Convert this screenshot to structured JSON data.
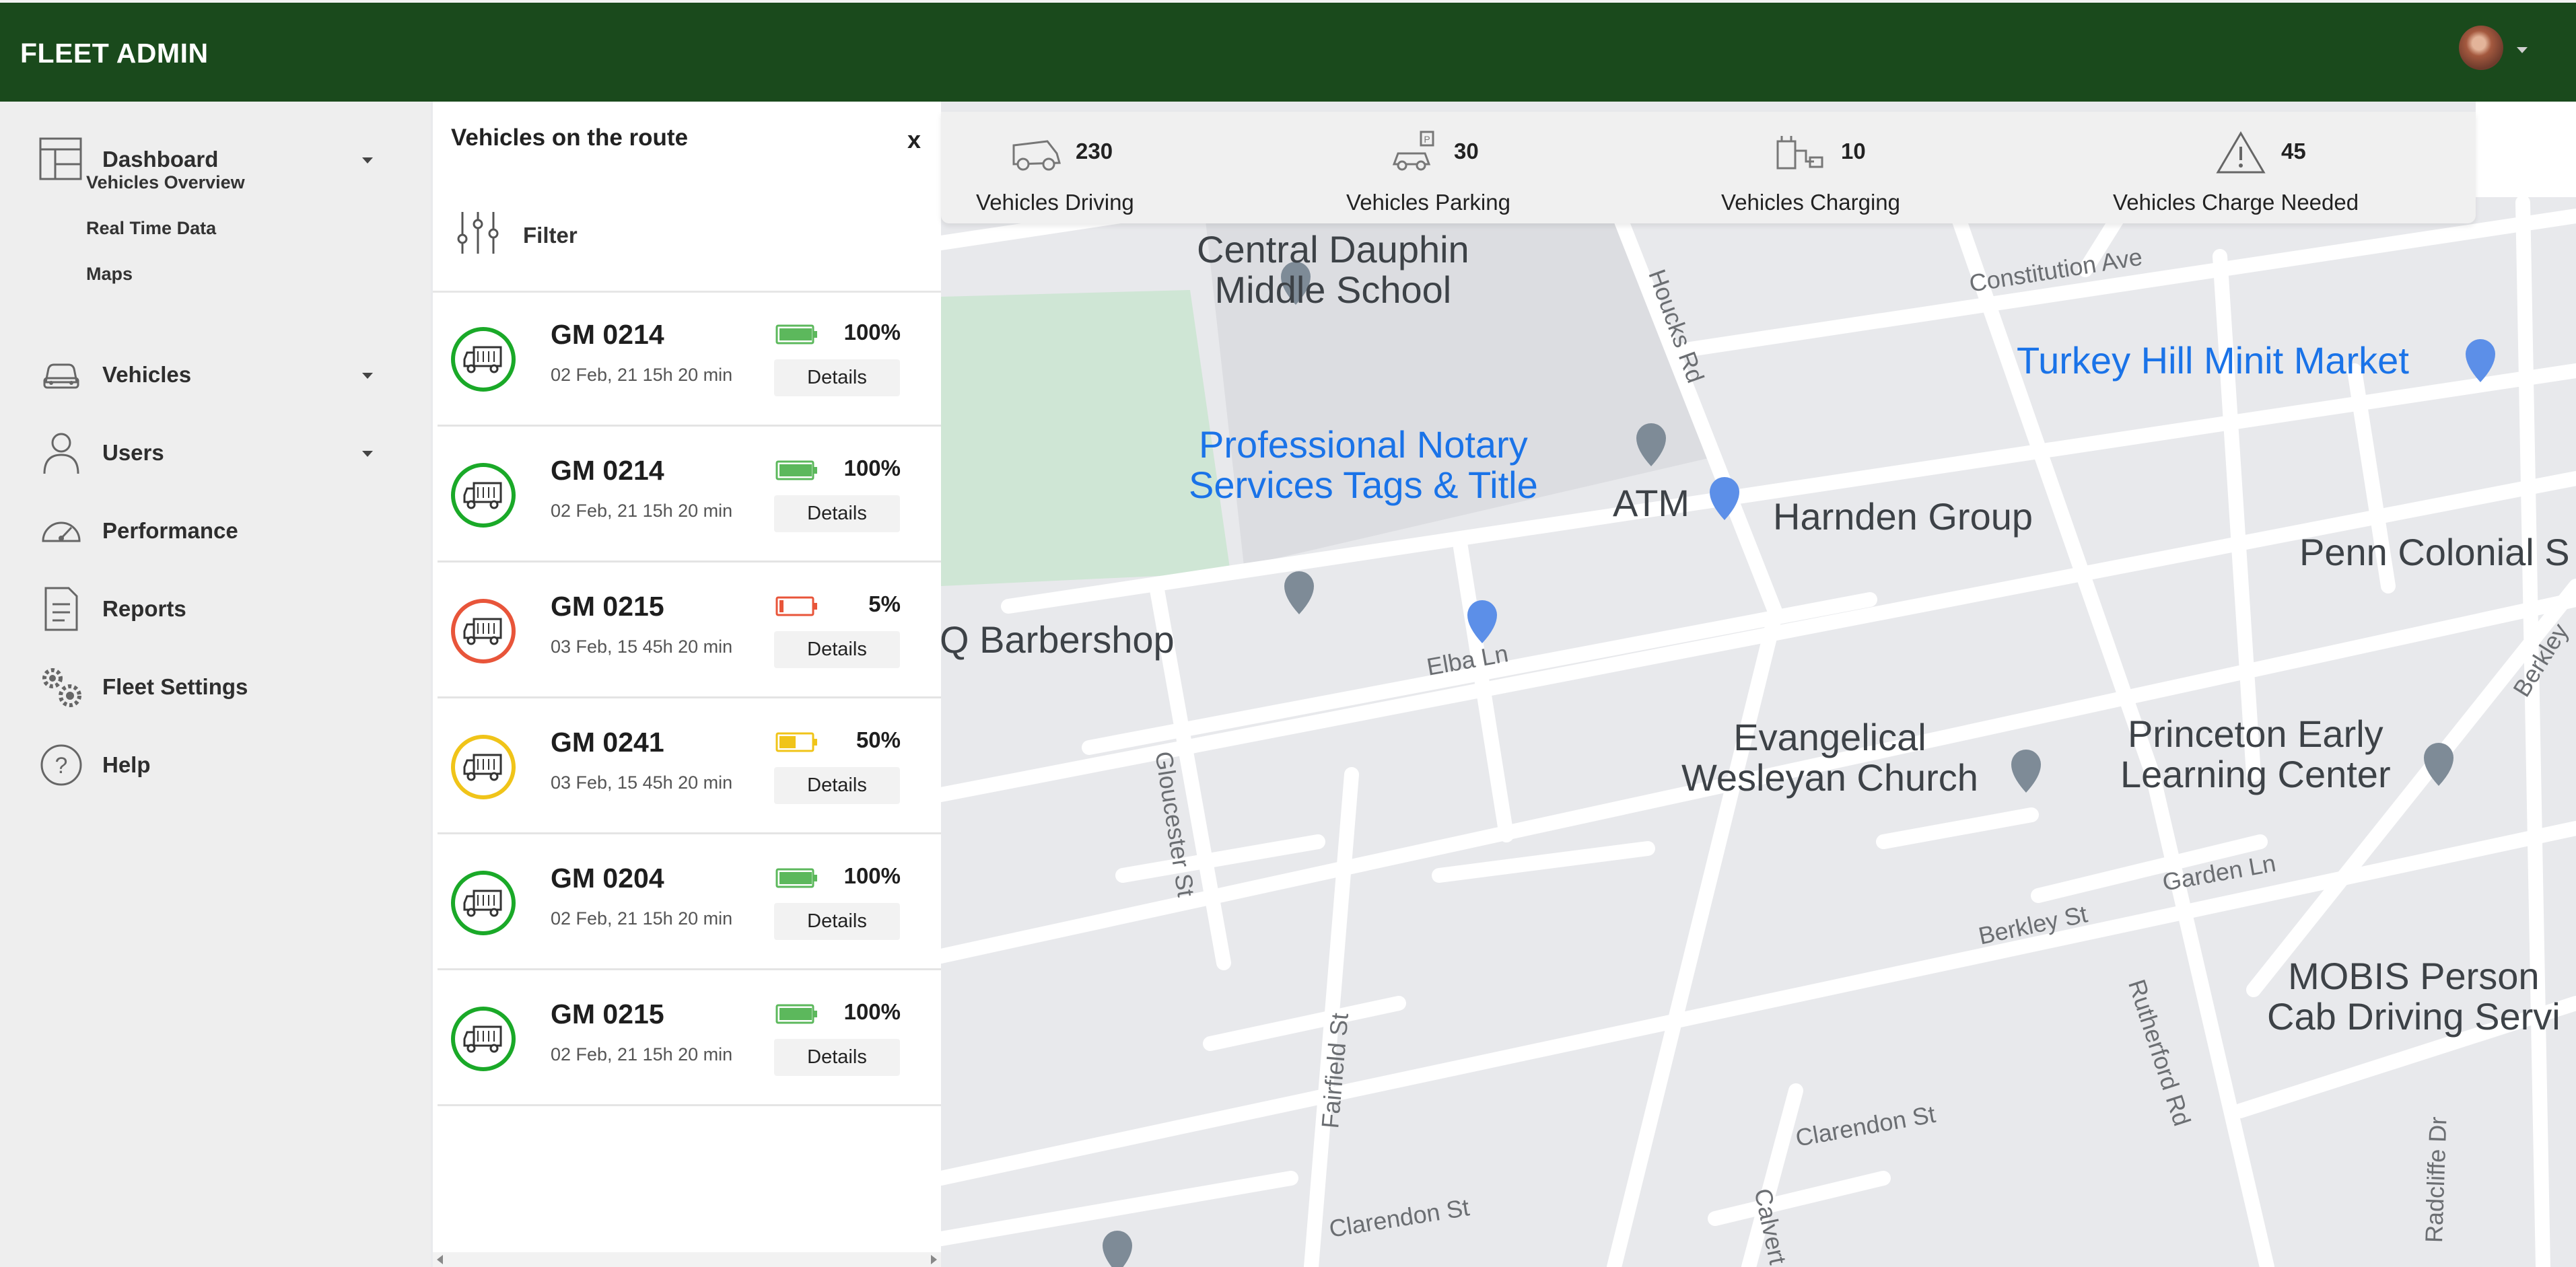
{
  "app": {
    "title": "FLEET ADMIN"
  },
  "sidebar": {
    "dashboard": {
      "label": "Dashboard",
      "subitems": [
        "Vehicles Overview",
        "Real Time Data",
        "Maps"
      ]
    },
    "items": [
      {
        "label": "Vehicles",
        "icon": "car-icon"
      },
      {
        "label": "Users",
        "icon": "user-icon"
      },
      {
        "label": "Performance",
        "icon": "gauge-icon"
      },
      {
        "label": "Reports",
        "icon": "report-icon"
      },
      {
        "label": "Fleet Settings",
        "icon": "gears-icon"
      },
      {
        "label": "Help",
        "icon": "help-icon"
      }
    ]
  },
  "panel": {
    "title": "Vehicles on the route",
    "close_label": "x",
    "filter_label": "Filter",
    "details_label": "Details",
    "vehicles": [
      {
        "id": "GM 0214",
        "time": "02 Feb, 21 15h 20 min",
        "battery": "100%",
        "level": 1.0,
        "status": "green"
      },
      {
        "id": "GM 0214",
        "time": "02 Feb, 21 15h 20 min",
        "battery": "100%",
        "level": 1.0,
        "status": "green"
      },
      {
        "id": "GM 0215",
        "time": "03 Feb, 15 45h 20 min",
        "battery": "5%",
        "level": 0.05,
        "status": "red"
      },
      {
        "id": "GM 0241",
        "time": "03 Feb, 15 45h 20 min",
        "battery": "50%",
        "level": 0.5,
        "status": "yellow"
      },
      {
        "id": "GM 0204",
        "time": "02 Feb, 21 15h 20 min",
        "battery": "100%",
        "level": 1.0,
        "status": "green"
      },
      {
        "id": "GM 0215",
        "time": "02 Feb, 21 15h 20 min",
        "battery": "100%",
        "level": 1.0,
        "status": "green"
      }
    ]
  },
  "status_colors": {
    "green": "#1aa928",
    "red": "#e8553a",
    "yellow": "#f0c419"
  },
  "battery_colors": {
    "green": "#5cb85c",
    "red": "#e8553a",
    "yellow": "#f0c419"
  },
  "stats": [
    {
      "count": "230",
      "label": "Vehicles Driving",
      "icon": "car-icon"
    },
    {
      "count": "30",
      "label": "Vehicles Parking",
      "icon": "parking-icon"
    },
    {
      "count": "10",
      "label": "Vehicles Charging",
      "icon": "charging-icon"
    },
    {
      "count": "45",
      "label": "Vehicles Charge Needed",
      "icon": "warning-icon"
    }
  ],
  "map": {
    "pois": [
      "Central Dauphin\nMiddle School",
      "Turkey Hill Minit Market",
      "Professional Notary\nServices Tags & Title",
      "ATM",
      "Harnden Group",
      "Penn Colonial S",
      "Q Barbershop",
      "Evangelical\nWesleyan Church",
      "Princeton Early\nLearning Center",
      "MOBIS Person\nCab Driving Servi"
    ],
    "streets": [
      "Constitution Ave",
      "Houcks Rd",
      "Elba Ln",
      "Gloucester St",
      "Berkley St",
      "Garden Ln",
      "Rutherford Rd",
      "Fairfield St",
      "Clarendon St",
      "Clarendon St",
      "Calvert",
      "Radcliffe Dr",
      "Berkley"
    ]
  }
}
